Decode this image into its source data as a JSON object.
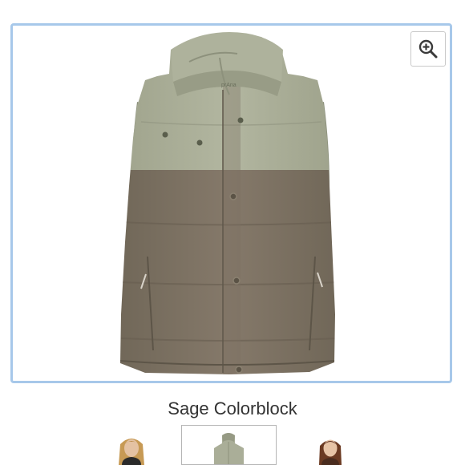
{
  "product": {
    "selected_color_label": "Sage Colorblock",
    "brand_mark": "prAna"
  },
  "gallery": {
    "zoom_icon": "zoom-in-icon",
    "thumbnails": [
      {
        "name": "model-front-thumbnail",
        "selected": false
      },
      {
        "name": "vest-flat-thumbnail",
        "selected": true
      },
      {
        "name": "model-side-thumbnail",
        "selected": false
      }
    ]
  },
  "colors": {
    "frame_border": "#a7c8ea",
    "vest_upper": "#a9ad96",
    "vest_lower": "#7c7263",
    "label_text": "#333333"
  }
}
